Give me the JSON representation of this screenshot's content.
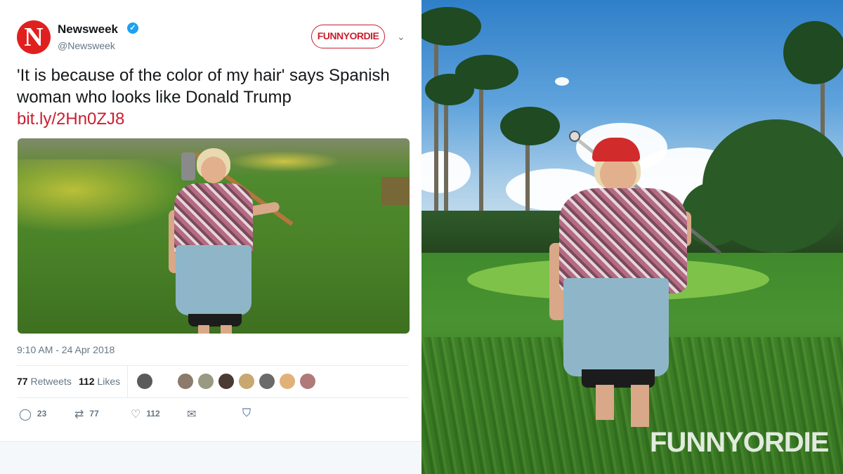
{
  "tweet": {
    "avatar_letter": "N",
    "account_name": "Newsweek",
    "verified_icon": "✓",
    "handle": "@Newsweek",
    "badge_label": "FUNNYORDIE",
    "caret": "⌄",
    "text": "'It is because of the color of my hair' says Spanish woman who looks like Donald Trump",
    "link": "bit.ly/2Hn0ZJ8",
    "timestamp": "9:10 AM - 24 Apr 2018",
    "retweets_count": "77",
    "retweets_label": "Retweets",
    "likes_count": "112",
    "likes_label": "Likes",
    "actions": {
      "reply_count": "23",
      "retweet_count": "77",
      "like_count": "112"
    },
    "icons": {
      "reply": "reply-icon",
      "retweet": "retweet-icon",
      "like": "heart-icon",
      "message": "envelope-icon",
      "pocket": "pocket-icon"
    }
  },
  "watermark": "FUNNYORDIE",
  "colors": {
    "link": "#c8202f",
    "verified": "#1da1f2",
    "avatar_bg": "#e0201f"
  }
}
